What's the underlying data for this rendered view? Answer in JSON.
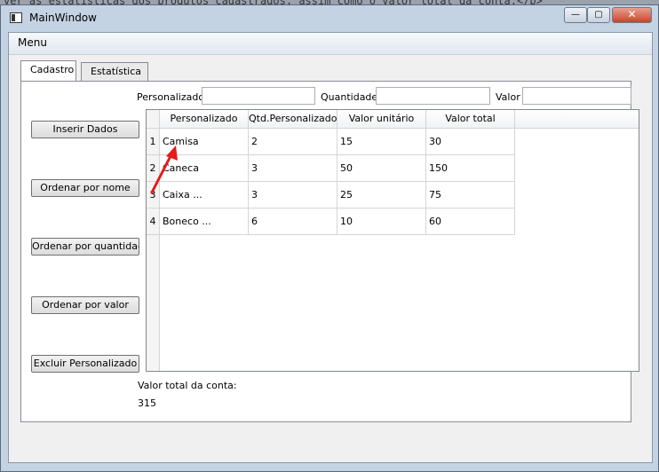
{
  "background_text": "ver as estatísticas dos produtos cadastrados, assim como o valor total da conta.</b>",
  "window": {
    "title": "MainWindow",
    "minimize": "—",
    "maximize": "▢",
    "close": "✕"
  },
  "menubar": {
    "menu": "Menu"
  },
  "tabs": [
    {
      "label": "Cadastro",
      "active": true
    },
    {
      "label": "Estatística",
      "active": false
    }
  ],
  "form": {
    "personalizado_label": "Personalizado",
    "personalizado_value": "",
    "quantidade_label": "Quantidade",
    "quantidade_value": "",
    "valor_label": "Valor",
    "valor_value": ""
  },
  "buttons": {
    "inserir": "Inserir Dados",
    "ordenar_nome": "Ordenar por nome",
    "ordenar_quantidade": "Ordenar por quantidade",
    "ordenar_valor": "Ordenar por valor",
    "excluir": "Excluir Personalizado"
  },
  "table": {
    "headers": [
      "Personalizado",
      "Qtd.Personalizado",
      "Valor unitário",
      "Valor total"
    ],
    "row_numbers": [
      "1",
      "2",
      "3",
      "4"
    ],
    "rows": [
      [
        "Camisa",
        "2",
        "15",
        "30"
      ],
      [
        "Caneca",
        "3",
        "50",
        "150"
      ],
      [
        "Caixa ...",
        "3",
        "25",
        "75"
      ],
      [
        "Boneco ...",
        "6",
        "10",
        "60"
      ]
    ]
  },
  "total": {
    "label": "Valor total da conta:",
    "value": "315"
  },
  "annotation": {
    "arrow_color": "#e31b1b"
  }
}
